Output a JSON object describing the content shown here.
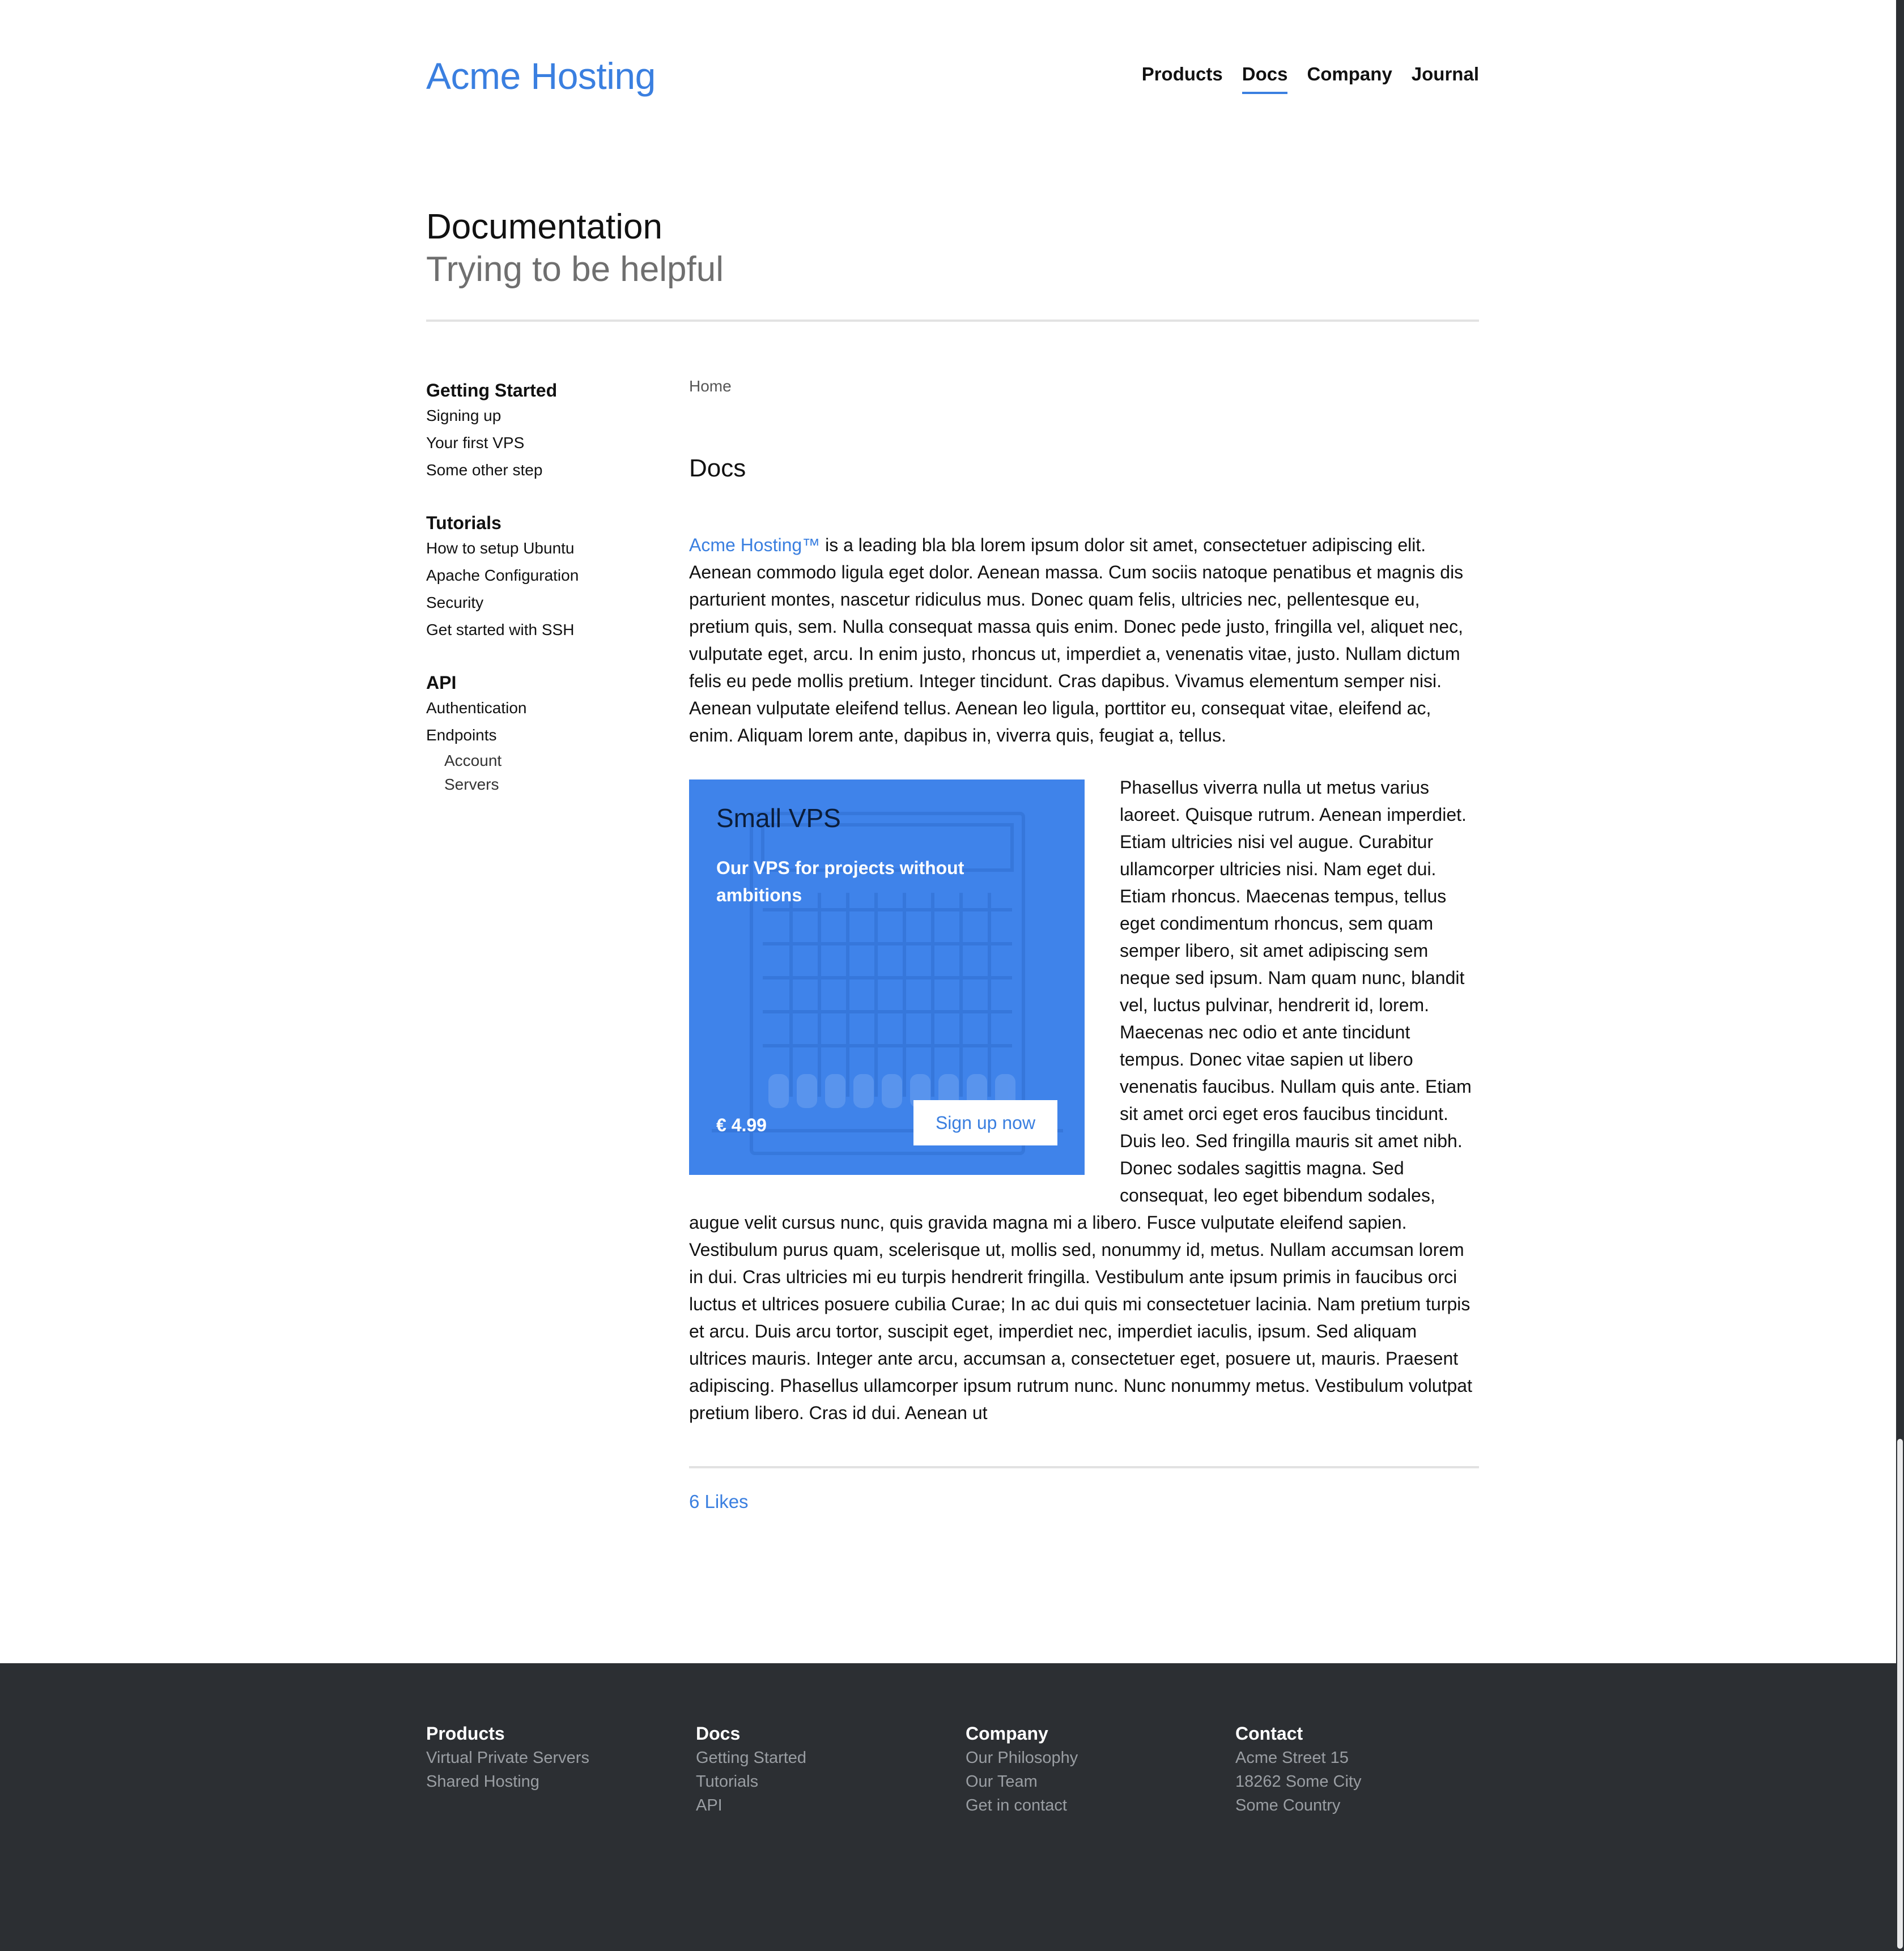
{
  "header": {
    "logo": "Acme Hosting",
    "nav": [
      "Products",
      "Docs",
      "Company",
      "Journal"
    ],
    "active_nav": "Docs"
  },
  "hero": {
    "title": "Documentation",
    "subtitle": "Trying to be helpful"
  },
  "sidebar": {
    "groups": [
      {
        "heading": "Getting Started",
        "links": [
          "Signing up",
          "Your first VPS",
          "Some other step"
        ]
      },
      {
        "heading": "Tutorials",
        "links": [
          "How to setup Ubuntu",
          "Apache Configuration",
          "Security",
          "Get started with SSH"
        ]
      },
      {
        "heading": "API",
        "links": [
          "Authentication",
          "Endpoints"
        ],
        "sublinks": [
          "Account",
          "Servers"
        ]
      }
    ]
  },
  "main": {
    "breadcrumb": "Home",
    "title": "Docs",
    "intro_brand": "Acme Hosting™",
    "intro_text": " is a leading bla bla lorem ipsum dolor sit amet, consectetuer adipiscing elit. Aenean commodo ligula eget dolor. Aenean massa. Cum sociis natoque penatibus et magnis dis parturient montes, nascetur ridiculus mus. Donec quam felis, ultricies nec, pellentesque eu, pretium quis, sem. Nulla consequat massa quis enim. Donec pede justo, fringilla vel, aliquet nec, vulputate eget, arcu. In enim justo, rhoncus ut, imperdiet a, venenatis vitae, justo. Nullam dictum felis eu pede mollis pretium. Integer tincidunt. Cras dapibus. Vivamus elementum semper nisi. Aenean vulputate eleifend tellus. Aenean leo ligula, porttitor eu, consequat vitae, eleifend ac, enim. Aliquam lorem ante, dapibus in, viverra quis, feugiat a, tellus.",
    "body_text": "Phasellus viverra nulla ut metus varius laoreet. Quisque rutrum. Aenean imperdiet. Etiam ultricies nisi vel augue. Curabitur ullamcorper ultricies nisi. Nam eget dui. Etiam rhoncus. Maecenas tempus, tellus eget condimentum rhoncus, sem quam semper libero, sit amet adipiscing sem neque sed ipsum. Nam quam nunc, blandit vel, luctus pulvinar, hendrerit id, lorem. Maecenas nec odio et ante tincidunt tempus. Donec vitae sapien ut libero venenatis faucibus. Nullam quis ante. Etiam sit amet orci eget eros faucibus tincidunt. Duis leo. Sed fringilla mauris sit amet nibh. Donec sodales sagittis magna. Sed consequat, leo eget bibendum sodales, augue velit cursus nunc, quis gravida magna mi a libero. Fusce vulputate eleifend sapien. Vestibulum purus quam, scelerisque ut, mollis sed, nonummy id, metus. Nullam accumsan lorem in dui. Cras ultricies mi eu turpis hendrerit fringilla. Vestibulum ante ipsum primis in faucibus orci luctus et ultrices posuere cubilia Curae; In ac dui quis mi consectetuer lacinia. Nam pretium turpis et arcu. Duis arcu tortor, suscipit eget, imperdiet nec, imperdiet iaculis, ipsum. Sed aliquam ultrices mauris. Integer ante arcu, accumsan a, consectetuer eget, posuere ut, mauris. Praesent adipiscing. Phasellus ullamcorper ipsum rutrum nunc. Nunc nonummy metus. Vestibulum volutpat pretium libero. Cras id dui. Aenean ut",
    "likes": "6 Likes"
  },
  "card": {
    "title": "Small VPS",
    "description": "Our VPS for projects without ambitions",
    "price": "€ 4.99",
    "button": "Sign up now"
  },
  "footer": {
    "columns": [
      {
        "heading": "Products",
        "links": [
          "Virtual Private Servers",
          "Shared Hosting"
        ]
      },
      {
        "heading": "Docs",
        "links": [
          "Getting Started",
          "Tutorials",
          "API"
        ]
      },
      {
        "heading": "Company",
        "links": [
          "Our Philosophy",
          "Our Team",
          "Get in contact"
        ]
      },
      {
        "heading": "Contact",
        "links": [
          "Acme Street 15",
          "18262 Some City",
          "Some Country"
        ]
      }
    ]
  },
  "colors": {
    "accent": "#3a7fe0",
    "card_bg": "#3f83ea",
    "footer_bg": "#2c2f33",
    "footer_link": "#9a9ea3"
  }
}
